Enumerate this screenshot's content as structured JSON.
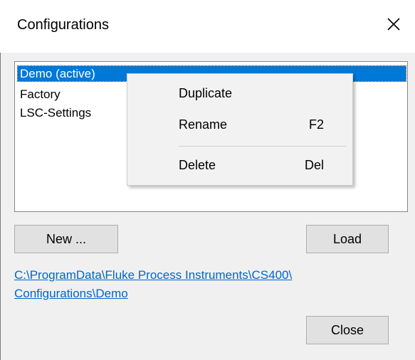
{
  "window": {
    "title": "Configurations",
    "close_icon": "close-icon"
  },
  "config_list": {
    "items": [
      {
        "label": "Demo (active)",
        "selected": true
      },
      {
        "label": "Factory",
        "selected": false
      },
      {
        "label": "LSC-Settings",
        "selected": false
      }
    ]
  },
  "context_menu": {
    "items": [
      {
        "label": "Duplicate",
        "shortcut": ""
      },
      {
        "label": "Rename",
        "shortcut": "F2"
      },
      {
        "label": "Delete",
        "shortcut": "Del"
      }
    ]
  },
  "buttons": {
    "new_label": "New ...",
    "load_label": "Load",
    "close_label": "Close"
  },
  "path": {
    "line1": "C:\\ProgramData\\Fluke Process Instruments\\CS400\\",
    "line2": "Configurations\\Demo"
  },
  "colors": {
    "selection": "#0078d7",
    "link": "#0066cc",
    "background": "#f0f0f0"
  }
}
